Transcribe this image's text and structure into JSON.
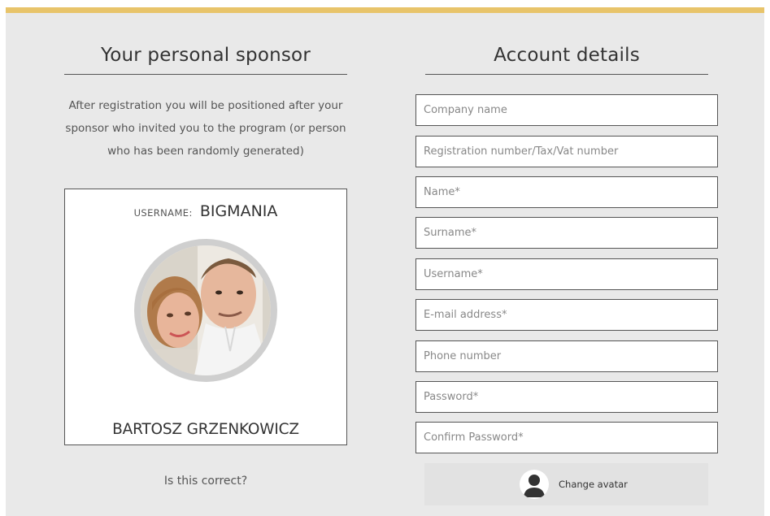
{
  "sponsor": {
    "title": "Your personal sponsor",
    "intro_line1": "After registration you will be positioned after your",
    "intro_line2": "sponsor who invited you to the program (or person",
    "intro_line3": "who has been randomly generated)",
    "username_label": "Username:",
    "username_value": "BIGMANIA",
    "full_name": "BARTOSZ GRZENKOWICZ",
    "confirm_text": "Is this correct?"
  },
  "account": {
    "title": "Account details",
    "fields": [
      {
        "placeholder": "Company name"
      },
      {
        "placeholder": "Registration number/Tax/Vat number"
      },
      {
        "placeholder": "Name*"
      },
      {
        "placeholder": "Surname*"
      },
      {
        "placeholder": "Username*"
      },
      {
        "placeholder": "E-mail address*"
      },
      {
        "placeholder": "Phone number"
      },
      {
        "placeholder": "Password*"
      },
      {
        "placeholder": "Confirm Password*"
      }
    ],
    "change_avatar_label": "Change avatar"
  },
  "colors": {
    "accent_bar": "#e8c46a",
    "panel_bg": "#e9e9e9"
  },
  "icons": {
    "avatar_placeholder": "user-avatar-icon"
  }
}
